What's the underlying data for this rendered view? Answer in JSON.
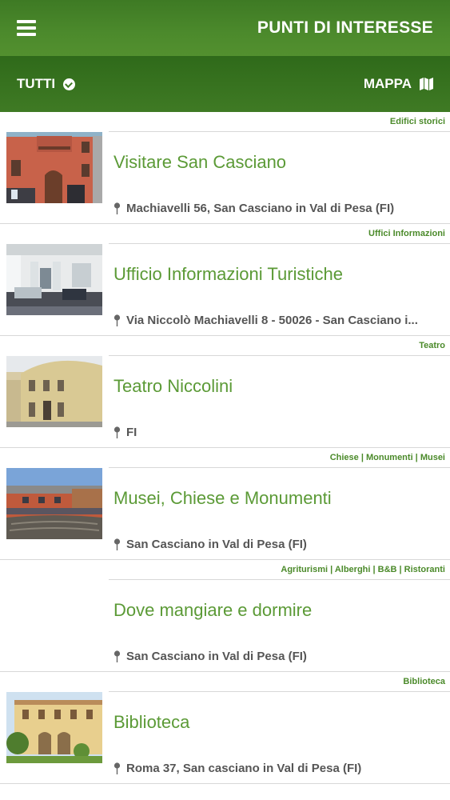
{
  "header": {
    "title": "PUNTI DI INTERESSE",
    "menu_icon": "hamburger-icon"
  },
  "filterbar": {
    "filter_label": "TUTTI",
    "filter_icon": "check-circle-icon",
    "map_label": "MAPPA",
    "map_icon": "map-icon"
  },
  "colors": {
    "accent": "#4b8a2a",
    "title_green": "#5b9a36",
    "header_green": "#3e7a24"
  },
  "items": [
    {
      "category": "Edifici storici",
      "title": "Visitare San Casciano",
      "address": "Machiavelli 56, San Casciano in Val di Pesa (FI)",
      "has_image": true
    },
    {
      "category": "Uffici Informazioni",
      "title": "Ufficio Informazioni Turistiche",
      "address": "Via Niccolò Machiavelli 8 - 50026 - San Casciano i...",
      "has_image": true
    },
    {
      "category": "Teatro",
      "title": "Teatro Niccolini",
      "address": "FI",
      "has_image": true
    },
    {
      "category": "Chiese | Monumenti | Musei",
      "title": "Musei, Chiese e Monumenti",
      "address": "San Casciano in Val di Pesa (FI)",
      "has_image": true
    },
    {
      "category": "Agriturismi | Alberghi | B&B | Ristoranti",
      "title": "Dove mangiare e dormire",
      "address": "San Casciano in Val di Pesa (FI)",
      "has_image": false
    },
    {
      "category": "Biblioteca",
      "title": "Biblioteca",
      "address": "Roma 37, San casciano in Val di Pesa (FI)",
      "has_image": true
    }
  ]
}
